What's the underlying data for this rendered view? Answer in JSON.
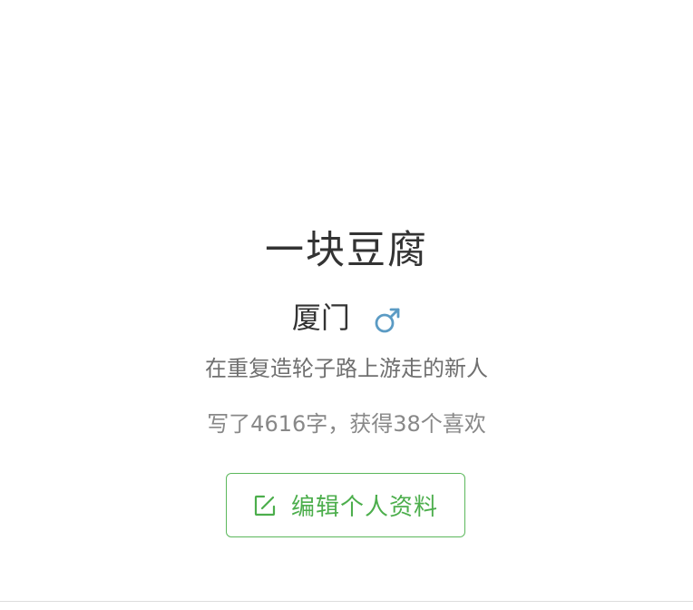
{
  "profile": {
    "name": "一块豆腐",
    "city": "厦门",
    "gender_icon": "male-symbol-icon",
    "bio": "在重复造轮子路上游走的新人",
    "stats": "写了4616字，获得38个喜欢",
    "edit_button": {
      "label": "编辑个人资料",
      "icon": "edit-icon"
    }
  },
  "colors": {
    "accent": "#4cae4c",
    "gender_icon": "#5b9bc4",
    "text_primary": "#333333",
    "text_secondary": "#6f6f6f"
  }
}
